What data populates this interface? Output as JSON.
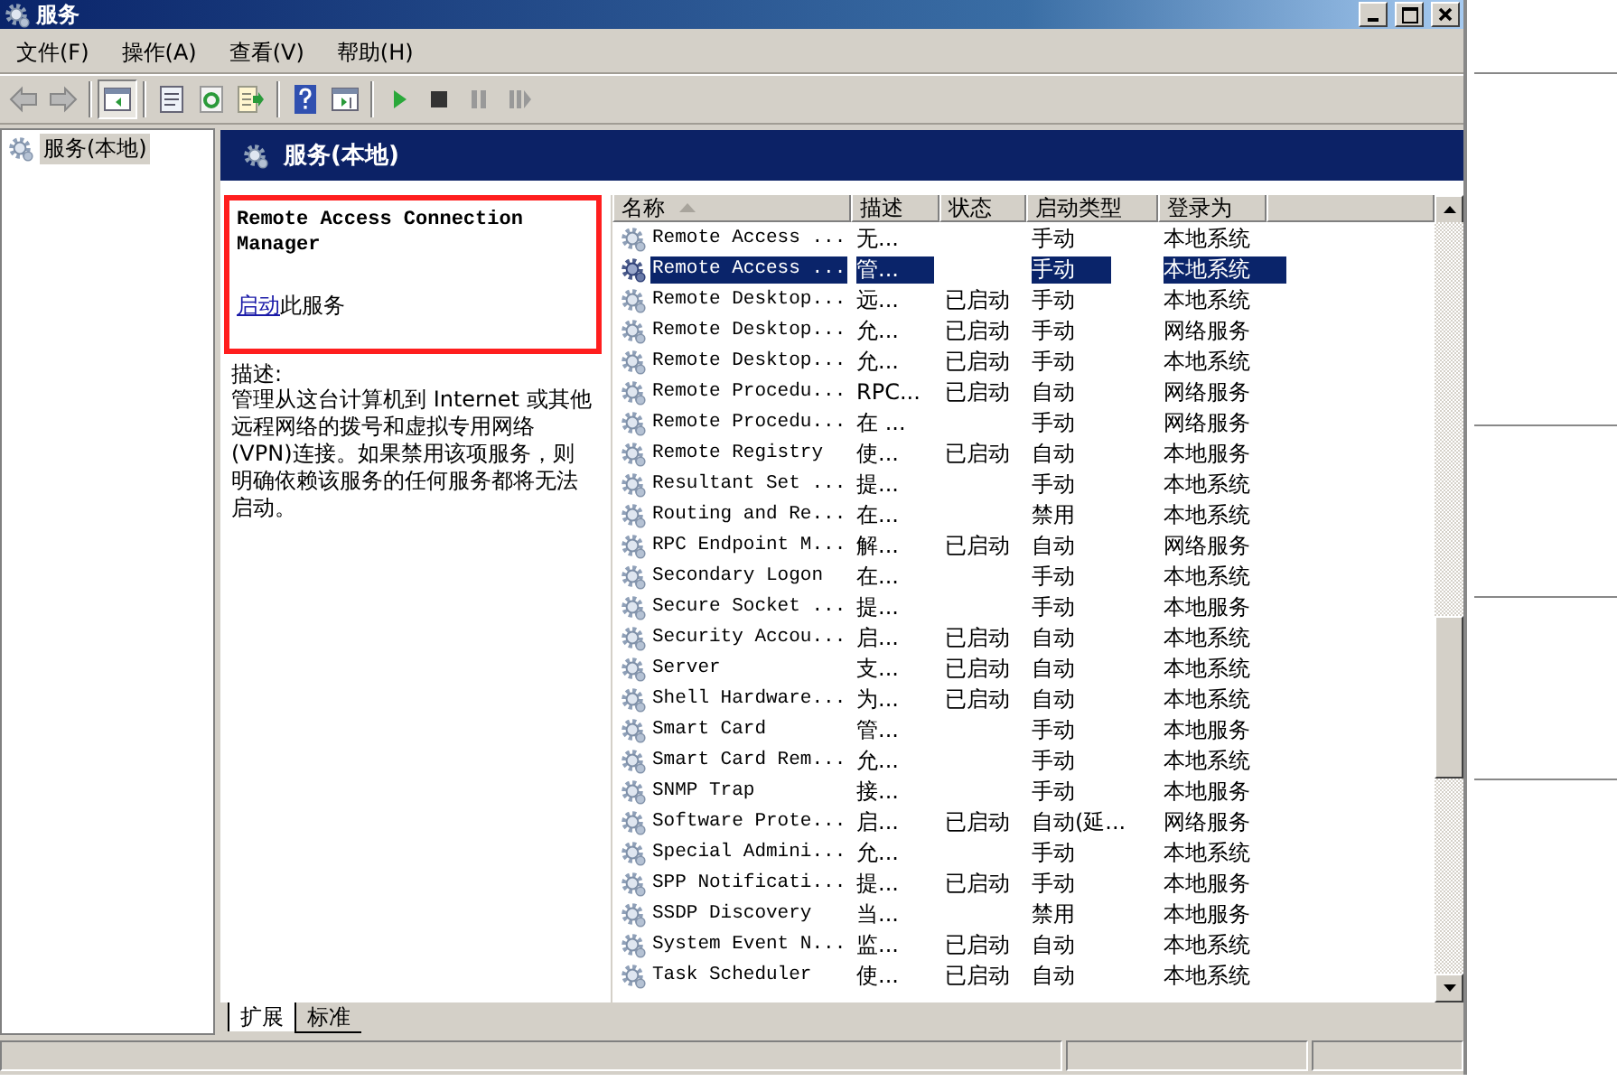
{
  "window": {
    "title": "服务"
  },
  "menu": [
    {
      "label": "文件(F)"
    },
    {
      "label": "操作(A)"
    },
    {
      "label": "查看(V)"
    },
    {
      "label": "帮助(H)"
    }
  ],
  "tree": [
    {
      "label": "服务(本地)",
      "selected": true
    }
  ],
  "panel_title": "服务(本地)",
  "detail": {
    "highlighted": true,
    "service_name": "Remote Access Connection Manager",
    "action_link": "启动",
    "action_text": "此服务",
    "description_label": "描述:",
    "description": "管理从这台计算机到 Internet 或其他远程网络的拨号和虚拟专用网络(VPN)连接。如果禁用该项服务，则明确依赖该服务的任何服务都将无法启动。"
  },
  "columns": [
    {
      "label": "名称",
      "sorted": true
    },
    {
      "label": "描述",
      "sorted": false
    },
    {
      "label": "状态",
      "sorted": false
    },
    {
      "label": "启动类型",
      "sorted": false
    },
    {
      "label": "登录为",
      "sorted": false
    }
  ],
  "rows": [
    {
      "name": "Remote Access ...",
      "description": "无...",
      "status": "",
      "startup_type": "手动",
      "log_on_as": "本地系统",
      "selected": false
    },
    {
      "name": "Remote Access ...",
      "description": "管...",
      "status": "",
      "startup_type": "手动",
      "log_on_as": "本地系统",
      "selected": true
    },
    {
      "name": "Remote Desktop...",
      "description": "远...",
      "status": "已启动",
      "startup_type": "手动",
      "log_on_as": "本地系统",
      "selected": false
    },
    {
      "name": "Remote Desktop...",
      "description": "允...",
      "status": "已启动",
      "startup_type": "手动",
      "log_on_as": "网络服务",
      "selected": false
    },
    {
      "name": "Remote Desktop...",
      "description": "允...",
      "status": "已启动",
      "startup_type": "手动",
      "log_on_as": "本地系统",
      "selected": false
    },
    {
      "name": "Remote Procedu...",
      "description": "RPC...",
      "status": "已启动",
      "startup_type": "自动",
      "log_on_as": "网络服务",
      "selected": false
    },
    {
      "name": "Remote Procedu...",
      "description": "在 ...",
      "status": "",
      "startup_type": "手动",
      "log_on_as": "网络服务",
      "selected": false
    },
    {
      "name": "Remote Registry",
      "description": "使...",
      "status": "已启动",
      "startup_type": "自动",
      "log_on_as": "本地服务",
      "selected": false
    },
    {
      "name": "Resultant Set ...",
      "description": "提...",
      "status": "",
      "startup_type": "手动",
      "log_on_as": "本地系统",
      "selected": false
    },
    {
      "name": "Routing and Re...",
      "description": "在...",
      "status": "",
      "startup_type": "禁用",
      "log_on_as": "本地系统",
      "selected": false
    },
    {
      "name": "RPC Endpoint M...",
      "description": "解...",
      "status": "已启动",
      "startup_type": "自动",
      "log_on_as": "网络服务",
      "selected": false
    },
    {
      "name": "Secondary Logon",
      "description": "在...",
      "status": "",
      "startup_type": "手动",
      "log_on_as": "本地系统",
      "selected": false
    },
    {
      "name": "Secure Socket ...",
      "description": "提...",
      "status": "",
      "startup_type": "手动",
      "log_on_as": "本地服务",
      "selected": false
    },
    {
      "name": "Security Accou...",
      "description": "启...",
      "status": "已启动",
      "startup_type": "自动",
      "log_on_as": "本地系统",
      "selected": false
    },
    {
      "name": "Server",
      "description": "支...",
      "status": "已启动",
      "startup_type": "自动",
      "log_on_as": "本地系统",
      "selected": false
    },
    {
      "name": "Shell Hardware...",
      "description": "为...",
      "status": "已启动",
      "startup_type": "自动",
      "log_on_as": "本地系统",
      "selected": false
    },
    {
      "name": "Smart Card",
      "description": "管...",
      "status": "",
      "startup_type": "手动",
      "log_on_as": "本地服务",
      "selected": false
    },
    {
      "name": "Smart Card Rem...",
      "description": "允...",
      "status": "",
      "startup_type": "手动",
      "log_on_as": "本地系统",
      "selected": false
    },
    {
      "name": "SNMP Trap",
      "description": "接...",
      "status": "",
      "startup_type": "手动",
      "log_on_as": "本地服务",
      "selected": false
    },
    {
      "name": "Software Prote...",
      "description": "启...",
      "status": "已启动",
      "startup_type": "自动(延...",
      "log_on_as": "网络服务",
      "selected": false
    },
    {
      "name": "Special Admini...",
      "description": "允...",
      "status": "",
      "startup_type": "手动",
      "log_on_as": "本地系统",
      "selected": false
    },
    {
      "name": "SPP Notificati...",
      "description": "提...",
      "status": "已启动",
      "startup_type": "手动",
      "log_on_as": "本地服务",
      "selected": false
    },
    {
      "name": "SSDP Discovery",
      "description": "当...",
      "status": "",
      "startup_type": "禁用",
      "log_on_as": "本地服务",
      "selected": false
    },
    {
      "name": "System Event N...",
      "description": "监...",
      "status": "已启动",
      "startup_type": "自动",
      "log_on_as": "本地系统",
      "selected": false
    },
    {
      "name": "Task Scheduler",
      "description": "使...",
      "status": "已启动",
      "startup_type": "自动",
      "log_on_as": "本地系统",
      "selected": false
    }
  ],
  "tabs": [
    {
      "label": "扩展",
      "selected": true
    },
    {
      "label": "标准",
      "selected": false
    }
  ]
}
